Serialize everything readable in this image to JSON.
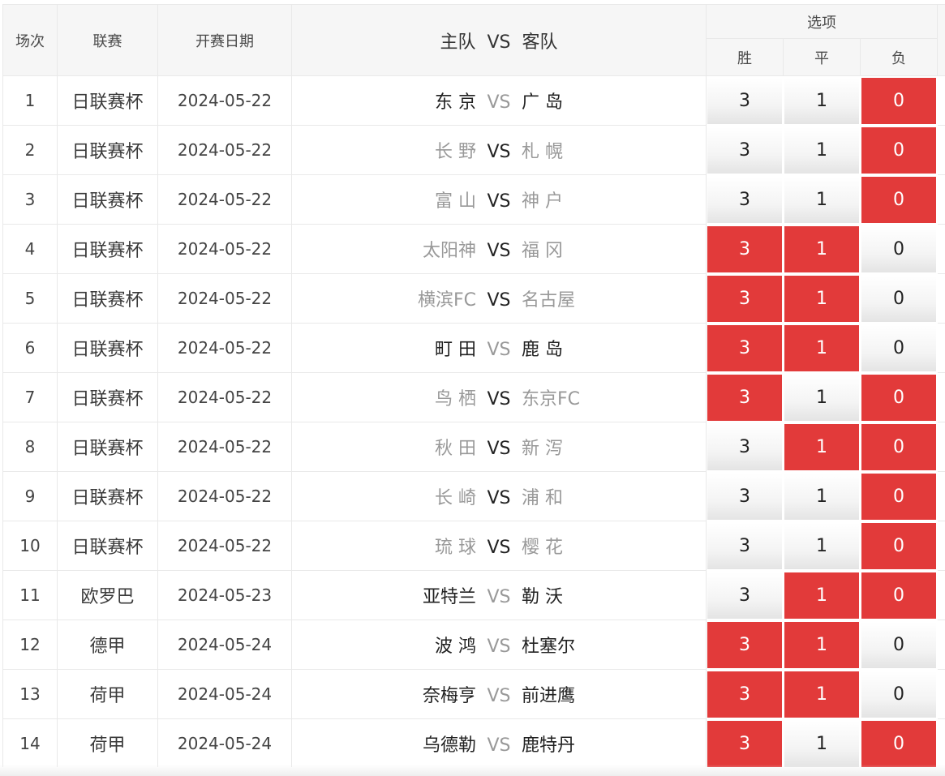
{
  "headers": {
    "index": "场次",
    "league": "联赛",
    "date": "开赛日期",
    "matchup_home": "主队",
    "matchup_vs": "VS",
    "matchup_away": "客队",
    "options": "选项",
    "win": "胜",
    "draw": "平",
    "loss": "负"
  },
  "vs_label": "VS",
  "colors": {
    "selected": "#e23a3a",
    "unselected": "#f4f4f4",
    "vs_dark": "#222222",
    "vs_light": "#999999"
  },
  "rows": [
    {
      "index": "1",
      "league": "日联赛杯",
      "date": "2024-05-22",
      "home": "东 京",
      "away": "广 岛",
      "dark_side": "home",
      "win": "3",
      "draw": "1",
      "loss": "0",
      "sel": [
        false,
        false,
        true
      ]
    },
    {
      "index": "2",
      "league": "日联赛杯",
      "date": "2024-05-22",
      "home": "长 野",
      "away": "札 幌",
      "dark_side": "vs",
      "win": "3",
      "draw": "1",
      "loss": "0",
      "sel": [
        false,
        false,
        true
      ]
    },
    {
      "index": "3",
      "league": "日联赛杯",
      "date": "2024-05-22",
      "home": "富 山",
      "away": "神 户",
      "dark_side": "vs",
      "win": "3",
      "draw": "1",
      "loss": "0",
      "sel": [
        false,
        false,
        true
      ]
    },
    {
      "index": "4",
      "league": "日联赛杯",
      "date": "2024-05-22",
      "home": "太阳神",
      "away": "福 冈",
      "dark_side": "vs",
      "win": "3",
      "draw": "1",
      "loss": "0",
      "sel": [
        true,
        true,
        false
      ]
    },
    {
      "index": "5",
      "league": "日联赛杯",
      "date": "2024-05-22",
      "home": "横滨FC",
      "away": "名古屋",
      "dark_side": "vs",
      "win": "3",
      "draw": "1",
      "loss": "0",
      "sel": [
        true,
        true,
        false
      ]
    },
    {
      "index": "6",
      "league": "日联赛杯",
      "date": "2024-05-22",
      "home": "町 田",
      "away": "鹿 岛",
      "dark_side": "home",
      "win": "3",
      "draw": "1",
      "loss": "0",
      "sel": [
        true,
        true,
        false
      ]
    },
    {
      "index": "7",
      "league": "日联赛杯",
      "date": "2024-05-22",
      "home": "鸟 栖",
      "away": "东京FC",
      "dark_side": "vs",
      "win": "3",
      "draw": "1",
      "loss": "0",
      "sel": [
        true,
        false,
        true
      ]
    },
    {
      "index": "8",
      "league": "日联赛杯",
      "date": "2024-05-22",
      "home": "秋 田",
      "away": "新 泻",
      "dark_side": "vs",
      "win": "3",
      "draw": "1",
      "loss": "0",
      "sel": [
        false,
        true,
        true
      ]
    },
    {
      "index": "9",
      "league": "日联赛杯",
      "date": "2024-05-22",
      "home": "长 崎",
      "away": "浦 和",
      "dark_side": "vs",
      "win": "3",
      "draw": "1",
      "loss": "0",
      "sel": [
        false,
        false,
        true
      ]
    },
    {
      "index": "10",
      "league": "日联赛杯",
      "date": "2024-05-22",
      "home": "琉 球",
      "away": "樱 花",
      "dark_side": "vs",
      "win": "3",
      "draw": "1",
      "loss": "0",
      "sel": [
        false,
        false,
        true
      ]
    },
    {
      "index": "11",
      "league": "欧罗巴",
      "date": "2024-05-23",
      "home": "亚特兰",
      "away": "勒 沃",
      "dark_side": "home",
      "win": "3",
      "draw": "1",
      "loss": "0",
      "sel": [
        false,
        true,
        true
      ]
    },
    {
      "index": "12",
      "league": "德甲",
      "date": "2024-05-24",
      "home": "波 鸿",
      "away": "杜塞尔",
      "dark_side": "home",
      "win": "3",
      "draw": "1",
      "loss": "0",
      "sel": [
        true,
        true,
        false
      ]
    },
    {
      "index": "13",
      "league": "荷甲",
      "date": "2024-05-24",
      "home": "奈梅亨",
      "away": "前进鹰",
      "dark_side": "home",
      "win": "3",
      "draw": "1",
      "loss": "0",
      "sel": [
        true,
        true,
        false
      ]
    },
    {
      "index": "14",
      "league": "荷甲",
      "date": "2024-05-24",
      "home": "乌德勒",
      "away": "鹿特丹",
      "dark_side": "home",
      "win": "3",
      "draw": "1",
      "loss": "0",
      "sel": [
        true,
        false,
        true
      ]
    }
  ]
}
